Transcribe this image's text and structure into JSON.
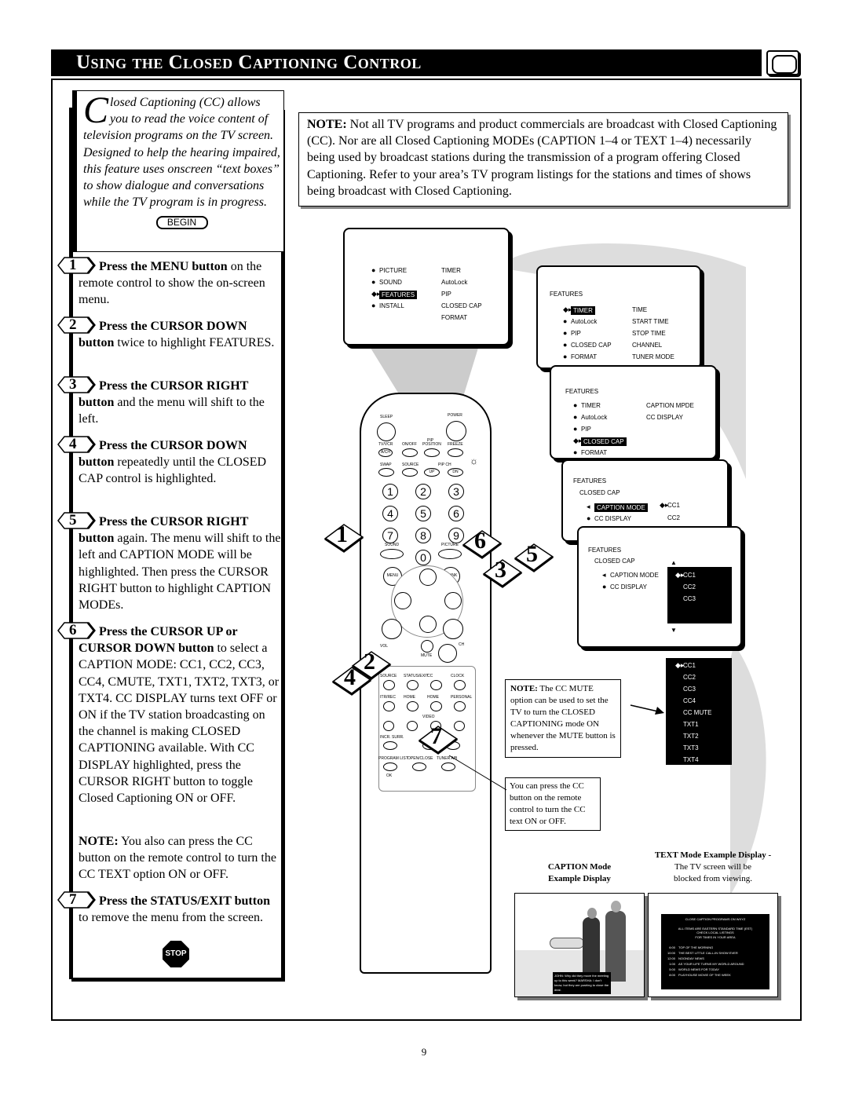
{
  "title": "Using the Closed Captioning Control",
  "intro": {
    "dropcap": "C",
    "text": "losed Captioning (CC) allows you to read the voice content of television programs on the TV screen.  Designed to help the hearing impaired, this feature uses onscreen “text boxes” to show dialogue and conversations while the TV program is in progress.",
    "begin": "BEGIN"
  },
  "steps": [
    {
      "n": "1",
      "bold": "Press the MENU button",
      "text": " on the remote control to show the on-screen menu."
    },
    {
      "n": "2",
      "bold": "Press the CURSOR DOWN button",
      "text": " twice to highlight FEATURES."
    },
    {
      "n": "3",
      "bold": "Press the CURSOR RIGHT button",
      "text": " and the menu will shift to the left."
    },
    {
      "n": "4",
      "bold": "Press the CURSOR DOWN button",
      "text": " repeatedly until the CLOSED CAP control is highlighted."
    },
    {
      "n": "5",
      "bold": "Press the CURSOR RIGHT button",
      "text": " again. The menu will shift to the left and CAPTION MODE will be highlighted.  Then press the CURSOR RIGHT button to highlight CAPTION MODEs."
    },
    {
      "n": "6",
      "bold": "Press the CURSOR UP or CURSOR DOWN button",
      "text": " to select a CAPTION MODE:  CC1, CC2, CC3, CC4, CMUTE, TXT1, TXT2, TXT3, or TXT4.  CC DISPLAY turns text OFF or ON if the TV station broadcasting on the channel is making CLOSED CAPTIONING available. With CC DISPLAY highlighted, press the CURSOR RIGHT button to toggle Closed Captioning ON or OFF."
    },
    {
      "n": "7",
      "bold": "Press the STATUS/EXIT button",
      "text": " to remove the menu from the screen."
    }
  ],
  "left_note": {
    "label": "NOTE:",
    "text": " You also can press the CC button on the remote control to turn the CC TEXT option ON or OFF."
  },
  "stop_label": "STOP",
  "top_note": {
    "label": "NOTE:",
    "text": "  Not all TV programs and product commercials are broadcast with Closed Captioning (CC).  Nor are all Closed Captioning  MODEs (CAPTION 1–4 or TEXT 1–4) necessarily being used by broadcast stations during the transmission of a program offering Closed Captioning.  Refer to your area’s TV program listings for the stations and times of shows being broadcast with Closed Captioning."
  },
  "menu1": {
    "left": [
      "PICTURE",
      "SOUND",
      "FEATURES",
      "INSTALL"
    ],
    "right": [
      "TIMER",
      "AutoLock",
      "PIP",
      "CLOSED  CAP",
      "FORMAT"
    ],
    "highlight": "FEATURES"
  },
  "menu2": {
    "header": "FEATURES",
    "left": [
      "TIMER",
      "AutoLock",
      "PIP",
      "CLOSED  CAP",
      "FORMAT"
    ],
    "right": [
      "TIME",
      "START  TIME",
      "STOP  TIME",
      "CHANNEL",
      "TUNER  MODE"
    ]
  },
  "menu3": {
    "header": "FEATURES",
    "left": [
      "TIMER",
      "AutoLock",
      "PIP",
      "CLOSED  CAP",
      "FORMAT"
    ],
    "right": [
      "CAPTION  MPDE",
      "CC  DISPLAY"
    ]
  },
  "menu4": {
    "header": "FEATURES",
    "sub": "CLOSED  CAP",
    "left": [
      "CAPTION  MODE",
      "CC  DISPLAY"
    ],
    "right": [
      "CC1",
      "CC2"
    ]
  },
  "menu5": {
    "header": "FEATURES",
    "sub": "CLOSED  CAP",
    "left": [
      "CAPTION  MODE",
      "CC  DISPLAY"
    ],
    "right": [
      "CC1",
      "CC2",
      "CC3"
    ]
  },
  "mode_list": [
    "CC1",
    "CC2",
    "CC3",
    "CC4",
    "CC MUTE",
    "TXT1",
    "TXT2",
    "TXT3",
    "TXT4"
  ],
  "mute_note": {
    "label": "NOTE:",
    "text": "  The CC MUTE option can be used to set the TV to turn the CLOSED CAPTIONING mode ON whenever the MUTE button is pressed."
  },
  "cc_note": "You can press the CC button on the remote control to turn the CC text ON or OFF.",
  "caption_example": {
    "title": "CAPTION Mode",
    "title2": "Example Display",
    "caption": "JOHN: Why did they move the meeting up to this week? MARSHA: I don't know, but they are pushing to close the deal."
  },
  "text_example": {
    "title": "TEXT  Mode Example Display -",
    "line1": "The TV screen will be",
    "line2": "blocked from viewing.",
    "screen": [
      "CLOSE CAPTION PROGRAMS ON WXYZ",
      "ALL ITEMS ARE EASTERN STANDARD TIME (EST)",
      "CHECK LOCAL LISTINGS",
      "FOR TIMES IN YOUR AREA"
    ],
    "listings": [
      [
        "6:00",
        "TOP OF THE MORNING"
      ],
      [
        "10:00",
        "THE BEST LITTLE CALL-IN SHOW EVER"
      ],
      [
        "12:00",
        "NOONDAY NEWS"
      ],
      [
        "1:00",
        "AS YOUR LIFE TURNS MY WORLD AROUND"
      ],
      [
        "5:00",
        "WORLD NEWS FOR TODAY"
      ],
      [
        "8:00",
        "PLAYHOUSE MOVIE OF THE WEEK"
      ]
    ]
  },
  "remote": {
    "sleep": "SLEEP",
    "power": "POWER",
    "pip": "PIP",
    "tvvcr": "TV/VCR",
    "ach": "A/CH",
    "onoff": "ON/OFF",
    "position": "POSITION",
    "freeze": "FREEZE",
    "swap": "SWAP",
    "source": "SOURCE",
    "pipch": "PIP CH",
    "up": "UP",
    "dn": "DN",
    "digits": [
      "1",
      "2",
      "3",
      "4",
      "5",
      "6",
      "7",
      "8",
      "9",
      "0"
    ],
    "sound": "SOUND",
    "picture": "PICTURE",
    "menu": "MENU",
    "link": "M LINK",
    "vol": "VOL",
    "ch": "CH",
    "mute": "MUTE",
    "row1": [
      "SOURCE",
      "STATUS/EXIT",
      "CC",
      "CLOCK"
    ],
    "row2": [
      "ITR/REC",
      "HOME",
      "HOME",
      "PERSONAL"
    ],
    "video": "VIDEO",
    "incr": "INCR. SURR.",
    "row4": [
      "PROGRAM LIST",
      "OPEN/CLOSE",
      "TUNER A/B"
    ],
    "ok": "OK"
  },
  "callouts": [
    "1",
    "6",
    "3",
    "5",
    "2",
    "4",
    "7"
  ],
  "page_number": "9"
}
